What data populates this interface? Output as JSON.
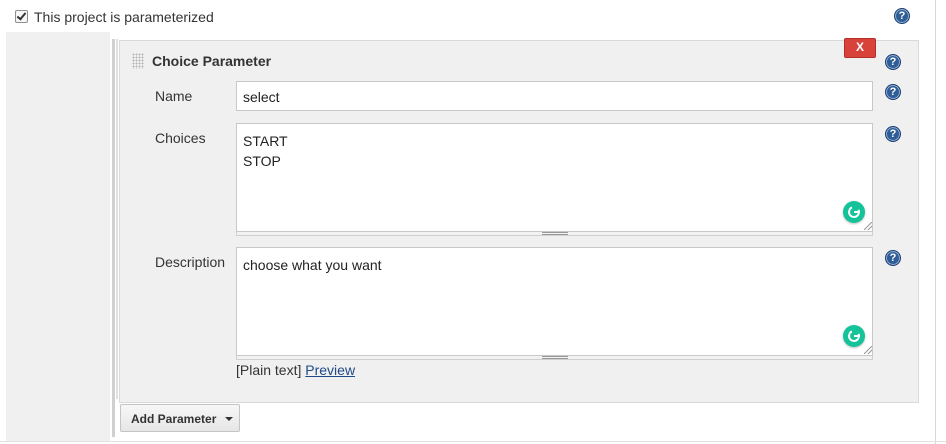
{
  "parameterized": {
    "label": "This project is parameterized",
    "checked": true
  },
  "parameter": {
    "title": "Choice Parameter",
    "delete_label": "X",
    "name_label": "Name",
    "name_value": "select",
    "choices_label": "Choices",
    "choices_value": "START\nSTOP",
    "description_label": "Description",
    "description_value": "choose what you want",
    "format_text": "[Plain text]",
    "preview_link": "Preview"
  },
  "add_parameter_label": "Add Parameter",
  "help_glyph": "?",
  "icons": {
    "help": "help-icon",
    "grammarly": "grammarly-icon",
    "drag": "drag-handle-icon",
    "caret": "caret-down-icon"
  },
  "colors": {
    "delete": "#d9423b",
    "help": "#2f5d96",
    "grammarly": "#15c39a",
    "link": "#204a87"
  }
}
